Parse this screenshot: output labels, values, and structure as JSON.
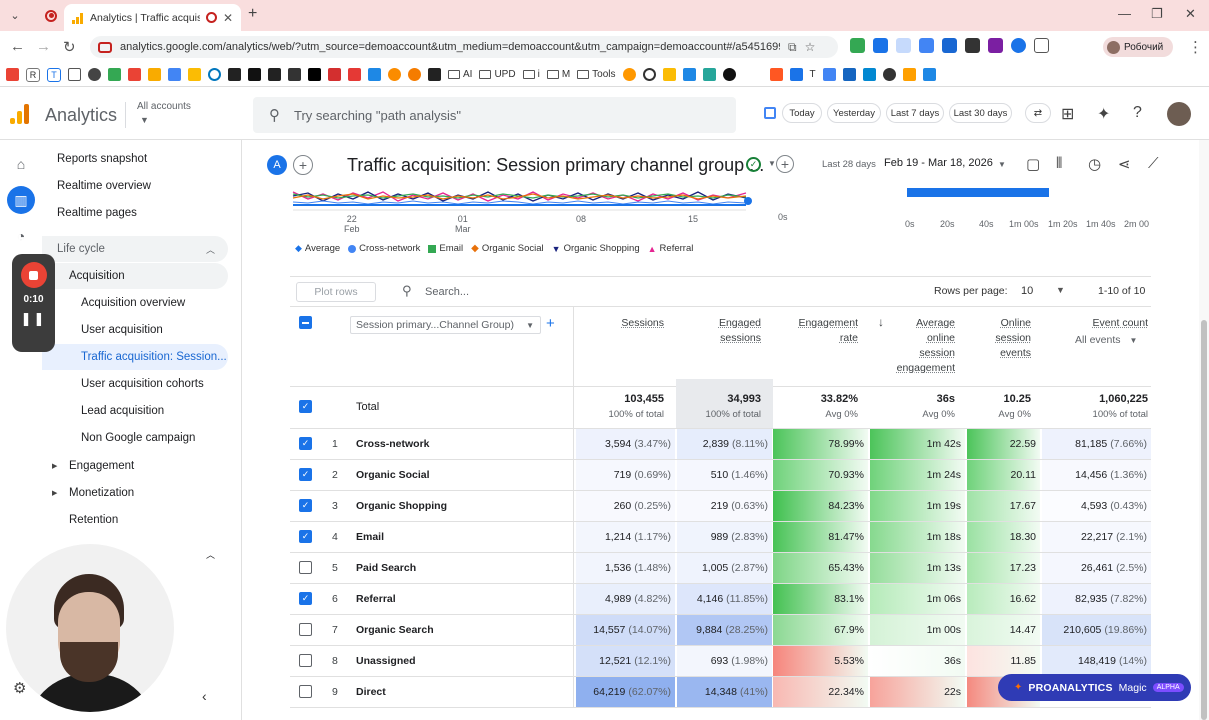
{
  "browser": {
    "tab_title": "Analytics | Traffic acquisition",
    "url": "analytics.google.com/analytics/web/?utm_source=demoaccount&utm_medium=demoaccount&utm_campaign=demoaccount#/a54516992...",
    "profile_label": "Робочий",
    "bookmarks": [
      {
        "label": "AI"
      },
      {
        "label": "UPD"
      },
      {
        "label": "i"
      },
      {
        "label": "M"
      },
      {
        "label": "Tools"
      }
    ],
    "bookmark_letters": [
      "E",
      "R",
      "T"
    ],
    "ext_letter": "T"
  },
  "header": {
    "app_name": "Analytics",
    "account_label": "All accounts",
    "search_placeholder": "Try searching \"path analysis\"",
    "chips": [
      "Today",
      "Yesterday",
      "Last 7 days",
      "Last 30 days"
    ]
  },
  "sidebar": {
    "items": [
      {
        "label": "Reports snapshot",
        "indent": 0
      },
      {
        "label": "Realtime overview",
        "indent": 0
      },
      {
        "label": "Realtime pages",
        "indent": 0
      },
      {
        "label": "Life cycle",
        "indent": 0,
        "section": true
      },
      {
        "label": "Acquisition",
        "indent": 1
      },
      {
        "label": "Acquisition overview",
        "indent": 2
      },
      {
        "label": "User acquisition",
        "indent": 2
      },
      {
        "label": "Traffic acquisition: Session...",
        "indent": 2,
        "selected": true
      },
      {
        "label": "User acquisition cohorts",
        "indent": 2
      },
      {
        "label": "Lead acquisition",
        "indent": 2
      },
      {
        "label": "Non Google campaign",
        "indent": 2
      },
      {
        "label": "Engagement",
        "indent": 1,
        "caret": true
      },
      {
        "label": "Monetization",
        "indent": 1,
        "caret": true
      },
      {
        "label": "Retention",
        "indent": 1
      }
    ]
  },
  "recorder": {
    "time": "0:10"
  },
  "report": {
    "badge": "A",
    "title": "Traffic acquisition: Session primary channel group ...",
    "date_label": "Last 28 days",
    "date_range": "Feb 19 - Mar 18, 2026"
  },
  "chart": {
    "x_ticks": [
      {
        "label": "22",
        "sub": "Feb"
      },
      {
        "label": "01",
        "sub": "Mar"
      },
      {
        "label": "08",
        "sub": ""
      },
      {
        "label": "15",
        "sub": ""
      }
    ],
    "y_label_left_end": "0s",
    "bar_ticks": [
      "0s",
      "20s",
      "40s",
      "1m 00s",
      "1m 20s",
      "1m 40s",
      "2m 00"
    ],
    "legend": [
      {
        "label": "Average",
        "color": "#1a73e8",
        "shape": "drop"
      },
      {
        "label": "Cross-network",
        "color": "#4285f4",
        "shape": "circle"
      },
      {
        "label": "Email",
        "color": "#34a853",
        "shape": "square"
      },
      {
        "label": "Organic Social",
        "color": "#e8710a",
        "shape": "diamond"
      },
      {
        "label": "Organic Shopping",
        "color": "#1a237e",
        "shape": "triangle"
      },
      {
        "label": "Referral",
        "color": "#e52592",
        "shape": "triangle-up"
      }
    ]
  },
  "table": {
    "toolbar": {
      "plot_rows": "Plot rows",
      "search_placeholder": "Search...",
      "rows_per_page_label": "Rows per page:",
      "rows_per_page": "10",
      "range": "1-10 of 10"
    },
    "dimension": "Session primary...Channel Group)",
    "columns": [
      {
        "label": "Sessions"
      },
      {
        "label": "Engaged sessions"
      },
      {
        "label": "Engagement rate"
      },
      {
        "label": "Average online session engagement"
      },
      {
        "label": "Online session events"
      },
      {
        "label": "Event count",
        "sub": "All events"
      }
    ],
    "total": {
      "label": "Total",
      "values": [
        "103,455",
        "34,993",
        "33.82%",
        "36s",
        "10.25",
        "1,060,225"
      ],
      "subs": [
        "100% of total",
        "100% of total",
        "Avg 0%",
        "Avg 0%",
        "Avg 0%",
        "100% of total"
      ]
    },
    "rows": [
      {
        "n": "1",
        "name": "Cross-network",
        "checked": true,
        "sessions": "3,594",
        "sessions_pct": "(3.47%)",
        "engaged": "2,839",
        "engaged_pct": "(8.11%)",
        "rate": "78.99%",
        "avg": "1m 42s",
        "events": "22.59",
        "count": "81,185",
        "count_pct": "(7.66%)"
      },
      {
        "n": "2",
        "name": "Organic Social",
        "checked": true,
        "sessions": "719",
        "sessions_pct": "(0.69%)",
        "engaged": "510",
        "engaged_pct": "(1.46%)",
        "rate": "70.93%",
        "avg": "1m 24s",
        "events": "20.11",
        "count": "14,456",
        "count_pct": "(1.36%)"
      },
      {
        "n": "3",
        "name": "Organic Shopping",
        "checked": true,
        "sessions": "260",
        "sessions_pct": "(0.25%)",
        "engaged": "219",
        "engaged_pct": "(0.63%)",
        "rate": "84.23%",
        "avg": "1m 19s",
        "events": "17.67",
        "count": "4,593",
        "count_pct": "(0.43%)"
      },
      {
        "n": "4",
        "name": "Email",
        "checked": true,
        "sessions": "1,214",
        "sessions_pct": "(1.17%)",
        "engaged": "989",
        "engaged_pct": "(2.83%)",
        "rate": "81.47%",
        "avg": "1m 18s",
        "events": "18.30",
        "count": "22,217",
        "count_pct": "(2.1%)"
      },
      {
        "n": "5",
        "name": "Paid Search",
        "checked": false,
        "sessions": "1,536",
        "sessions_pct": "(1.48%)",
        "engaged": "1,005",
        "engaged_pct": "(2.87%)",
        "rate": "65.43%",
        "avg": "1m 13s",
        "events": "17.23",
        "count": "26,461",
        "count_pct": "(2.5%)"
      },
      {
        "n": "6",
        "name": "Referral",
        "checked": true,
        "sessions": "4,989",
        "sessions_pct": "(4.82%)",
        "engaged": "4,146",
        "engaged_pct": "(11.85%)",
        "rate": "83.1%",
        "avg": "1m 06s",
        "events": "16.62",
        "count": "82,935",
        "count_pct": "(7.82%)"
      },
      {
        "n": "7",
        "name": "Organic Search",
        "checked": false,
        "sessions": "14,557",
        "sessions_pct": "(14.07%)",
        "engaged": "9,884",
        "engaged_pct": "(28.25%)",
        "rate": "67.9%",
        "avg": "1m 00s",
        "events": "14.47",
        "count": "210,605",
        "count_pct": "(19.86%)"
      },
      {
        "n": "8",
        "name": "Unassigned",
        "checked": false,
        "sessions": "12,521",
        "sessions_pct": "(12.1%)",
        "engaged": "693",
        "engaged_pct": "(1.98%)",
        "rate": "5.53%",
        "avg": "36s",
        "events": "11.85",
        "count": "148,419",
        "count_pct": "(14%)"
      },
      {
        "n": "9",
        "name": "Direct",
        "checked": false,
        "sessions": "64,219",
        "sessions_pct": "(62.07%)",
        "engaged": "14,348",
        "engaged_pct": "(41%)",
        "rate": "22.34%",
        "avg": "22s",
        "events": "",
        "count": "",
        "count_pct": ""
      }
    ]
  },
  "proanalytics": {
    "brand": "PROANALYTICS",
    "magic": "Magic",
    "tag": "ALPHA"
  }
}
